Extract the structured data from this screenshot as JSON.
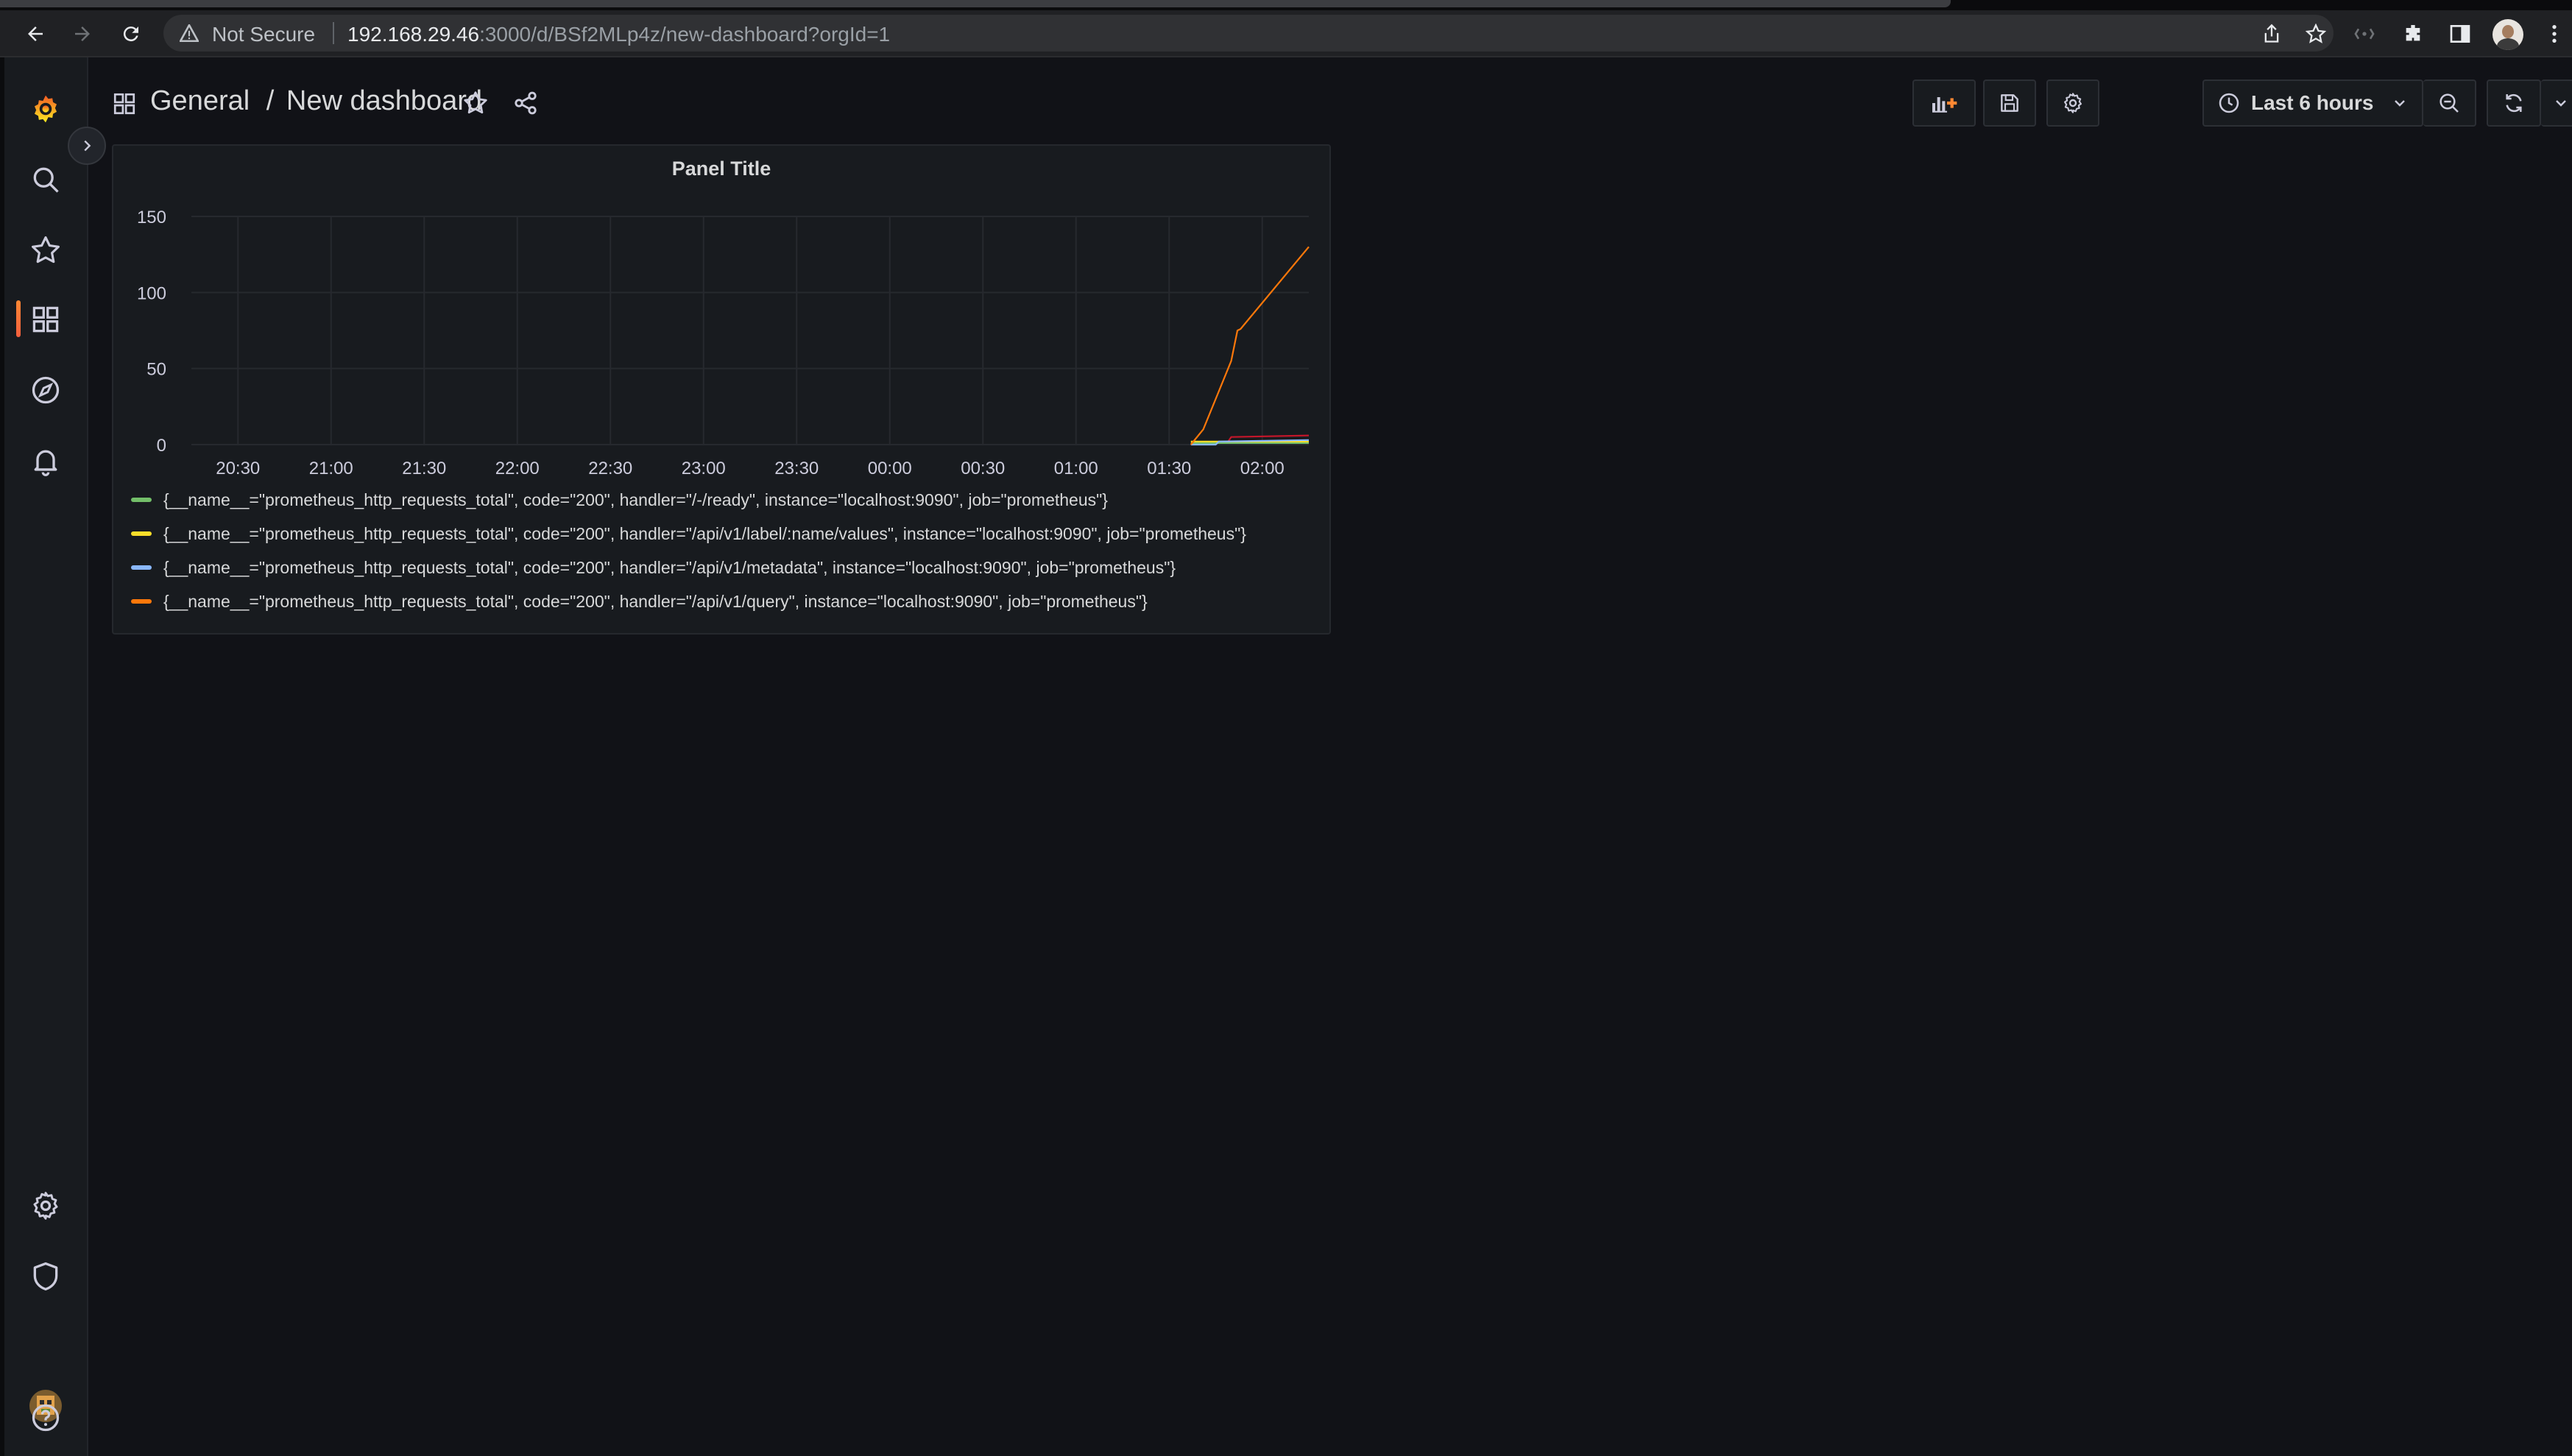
{
  "browser": {
    "security_label": "Not Secure",
    "url_host": "192.168.29.46",
    "url_rest": ":3000/d/BSf2MLp4z/new-dashboard?orgId=1"
  },
  "sidemenu": {
    "items": [
      "grafana-logo-icon",
      "search-icon",
      "starred-icon",
      "dashboards-icon",
      "explore-icon",
      "alerting-icon",
      "configuration-icon",
      "server-admin-shield-icon",
      "user-avatar",
      "help-icon"
    ],
    "active": "dashboards-icon"
  },
  "dashnav": {
    "folder": "General",
    "separator": "/",
    "title": "New dashboard",
    "time_range": "Last 6 hours"
  },
  "panel": {
    "title": "Panel Title"
  },
  "chart_data": {
    "type": "line",
    "title": "Panel Title",
    "xlabel": "",
    "ylabel": "",
    "x_ticks": [
      "20:30",
      "21:00",
      "21:30",
      "22:00",
      "22:30",
      "23:00",
      "23:30",
      "00:00",
      "00:30",
      "01:00",
      "01:30",
      "02:00"
    ],
    "y_ticks": [
      0,
      50,
      100,
      150
    ],
    "ylim": [
      0,
      150
    ],
    "x_minutes_range": [
      "20:15",
      "02:15"
    ],
    "grid": true,
    "legend_position": "bottom",
    "series": [
      {
        "name": "{__name__=\"prometheus_http_requests_total\", code=\"200\", handler=\"/-/ready\", instance=\"localhost:9090\", job=\"prometheus\"}",
        "color": "#73bf69",
        "x": [
          "01:37",
          "02:15"
        ],
        "y": [
          1,
          1
        ]
      },
      {
        "name": "{__name__=\"prometheus_http_requests_total\", code=\"200\", handler=\"/api/v1/label/:name/values\", instance=\"localhost:9090\", job=\"prometheus\"}",
        "color": "#fade2a",
        "x": [
          "01:37",
          "01:50",
          "02:15"
        ],
        "y": [
          2,
          2,
          2
        ]
      },
      {
        "name": "{__name__=\"prometheus_http_requests_total\", code=\"200\", handler=\"/api/v1/metadata\", instance=\"localhost:9090\", job=\"prometheus\"}",
        "color": "#8ab8ff",
        "x": [
          "01:37",
          "01:45",
          "01:46",
          "02:15"
        ],
        "y": [
          0,
          0,
          2,
          3
        ]
      },
      {
        "name": "{__name__=\"prometheus_http_requests_total\", code=\"200\", handler=\"/api/v1/query\", instance=\"localhost:9090\", job=\"prometheus\"}",
        "color": "#ff780a",
        "x": [
          "01:37",
          "01:41",
          "01:45",
          "01:50",
          "01:52",
          "01:53",
          "02:15"
        ],
        "y": [
          0,
          10,
          30,
          55,
          75,
          76,
          130
        ]
      }
    ],
    "extra_series": [
      {
        "color": "#c4162a",
        "x": [
          "01:49",
          "01:50",
          "02:15"
        ],
        "y": [
          2,
          5,
          6
        ]
      }
    ]
  }
}
